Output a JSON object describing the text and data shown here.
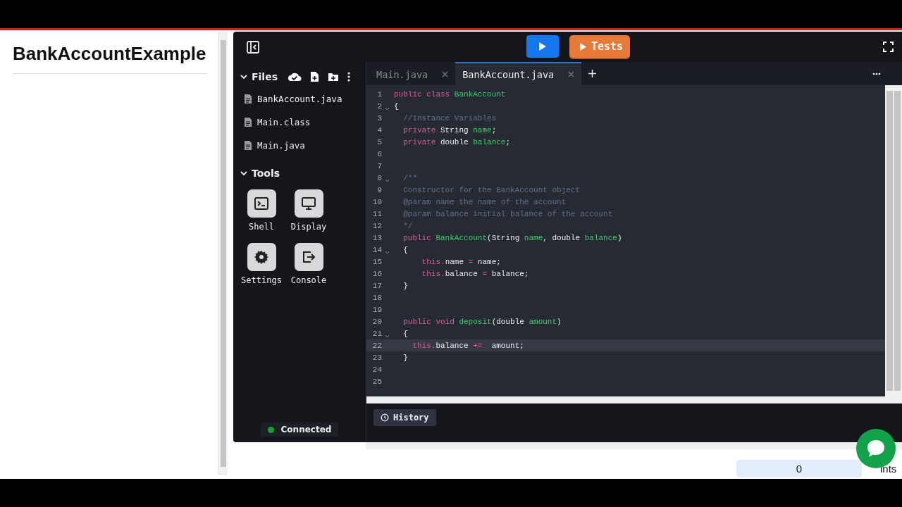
{
  "page": {
    "title": "BankAccountExample"
  },
  "toolbar": {
    "run_button": {
      "kind": "run"
    },
    "tests_button": {
      "label": "Tests"
    }
  },
  "files": {
    "title": "Files",
    "expanded": true,
    "items": [
      {
        "name": "BankAccount.java"
      },
      {
        "name": "Main.class"
      },
      {
        "name": "Main.java"
      }
    ]
  },
  "tools": {
    "title": "Tools",
    "expanded": true,
    "items": [
      {
        "label": "Shell",
        "kind": "shell"
      },
      {
        "label": "Display",
        "kind": "display"
      },
      {
        "label": "Settings",
        "kind": "settings"
      },
      {
        "label": "Console",
        "kind": "console"
      }
    ]
  },
  "status": {
    "label": "Connected",
    "color": "#17a32b"
  },
  "tabs": [
    {
      "label": "Main.java",
      "selected": false
    },
    {
      "label": "BankAccount.java",
      "selected": true
    }
  ],
  "code_lines": [
    {
      "number": "1",
      "fold": false,
      "current": false,
      "tokens": [
        {
          "kind": "keyword",
          "text": "public class "
        },
        {
          "kind": "name",
          "text": "BankAccount"
        }
      ]
    },
    {
      "number": "2",
      "fold": true,
      "current": false,
      "tokens": [
        {
          "kind": "plain",
          "text": "{"
        }
      ]
    },
    {
      "number": "3",
      "fold": false,
      "current": false,
      "tokens": [
        {
          "kind": "comment",
          "text": "  //Instance Variables"
        }
      ]
    },
    {
      "number": "4",
      "fold": false,
      "current": false,
      "tokens": [
        {
          "kind": "keyword",
          "text": "  private "
        },
        {
          "kind": "plain",
          "text": "String "
        },
        {
          "kind": "name",
          "text": "name"
        },
        {
          "kind": "plain",
          "text": ";"
        }
      ]
    },
    {
      "number": "5",
      "fold": false,
      "current": false,
      "tokens": [
        {
          "kind": "keyword",
          "text": "  private "
        },
        {
          "kind": "plain",
          "text": "double "
        },
        {
          "kind": "name",
          "text": "balance"
        },
        {
          "kind": "plain",
          "text": ";"
        }
      ]
    },
    {
      "number": "6",
      "fold": false,
      "current": false
    },
    {
      "number": "7",
      "fold": false,
      "current": false
    },
    {
      "number": "8",
      "fold": true,
      "current": false,
      "tokens": [
        {
          "kind": "comment",
          "text": "  /**"
        }
      ]
    },
    {
      "number": "9",
      "fold": false,
      "current": false,
      "tokens": [
        {
          "kind": "comment",
          "text": "  Constructor for the BankAccount object"
        }
      ]
    },
    {
      "number": "10",
      "fold": false,
      "current": false,
      "tokens": [
        {
          "kind": "comment",
          "text": "  @param name the name of the account"
        }
      ]
    },
    {
      "number": "11",
      "fold": false,
      "current": false,
      "tokens": [
        {
          "kind": "comment",
          "text": "  @param balance initial balance of the account"
        }
      ]
    },
    {
      "number": "12",
      "fold": false,
      "current": false,
      "tokens": [
        {
          "kind": "comment",
          "text": "  */"
        }
      ]
    },
    {
      "number": "13",
      "fold": false,
      "current": false,
      "tokens": [
        {
          "kind": "keyword",
          "text": "  public "
        },
        {
          "kind": "name",
          "text": "BankAccount"
        },
        {
          "kind": "plain",
          "text": "(String "
        },
        {
          "kind": "name",
          "text": "name"
        },
        {
          "kind": "plain",
          "text": ", double "
        },
        {
          "kind": "name",
          "text": "balance"
        },
        {
          "kind": "plain",
          "text": ")"
        }
      ]
    },
    {
      "number": "14",
      "fold": true,
      "current": false,
      "tokens": [
        {
          "kind": "plain",
          "text": "  {"
        }
      ]
    },
    {
      "number": "15",
      "fold": false,
      "current": false,
      "tokens": [
        {
          "kind": "keyword",
          "text": "      this."
        },
        {
          "kind": "plain",
          "text": "name "
        },
        {
          "kind": "keyword",
          "text": "="
        },
        {
          "kind": "plain",
          "text": " name;"
        }
      ]
    },
    {
      "number": "16",
      "fold": false,
      "current": false,
      "tokens": [
        {
          "kind": "keyword",
          "text": "      this."
        },
        {
          "kind": "plain",
          "text": "balance "
        },
        {
          "kind": "keyword",
          "text": "="
        },
        {
          "kind": "plain",
          "text": " balance;"
        }
      ]
    },
    {
      "number": "17",
      "fold": false,
      "current": false,
      "tokens": [
        {
          "kind": "plain",
          "text": "  }"
        }
      ]
    },
    {
      "number": "18",
      "fold": false,
      "current": false
    },
    {
      "number": "19",
      "fold": false,
      "current": false
    },
    {
      "number": "20",
      "fold": false,
      "current": false,
      "tokens": [
        {
          "kind": "keyword",
          "text": "  public void "
        },
        {
          "kind": "name",
          "text": "deposit"
        },
        {
          "kind": "plain",
          "text": "(double "
        },
        {
          "kind": "name",
          "text": "amount"
        },
        {
          "kind": "plain",
          "text": ")"
        }
      ]
    },
    {
      "number": "21",
      "fold": true,
      "current": false,
      "tokens": [
        {
          "kind": "plain",
          "text": "  {"
        }
      ]
    },
    {
      "number": "22",
      "fold": false,
      "current": true,
      "tokens": [
        {
          "kind": "keyword",
          "text": "    this."
        },
        {
          "kind": "plain",
          "text": "balance "
        },
        {
          "kind": "keyword",
          "text": "+="
        },
        {
          "kind": "plain",
          "text": "  amount;"
        }
      ]
    },
    {
      "number": "23",
      "fold": false,
      "current": false,
      "tokens": [
        {
          "kind": "plain",
          "text": "  }"
        }
      ]
    },
    {
      "number": "24",
      "fold": false,
      "current": false
    },
    {
      "number": "25",
      "fold": false,
      "current": false
    }
  ],
  "history_button": {
    "label": "History"
  },
  "score": {
    "value": "0",
    "label": "ints"
  }
}
